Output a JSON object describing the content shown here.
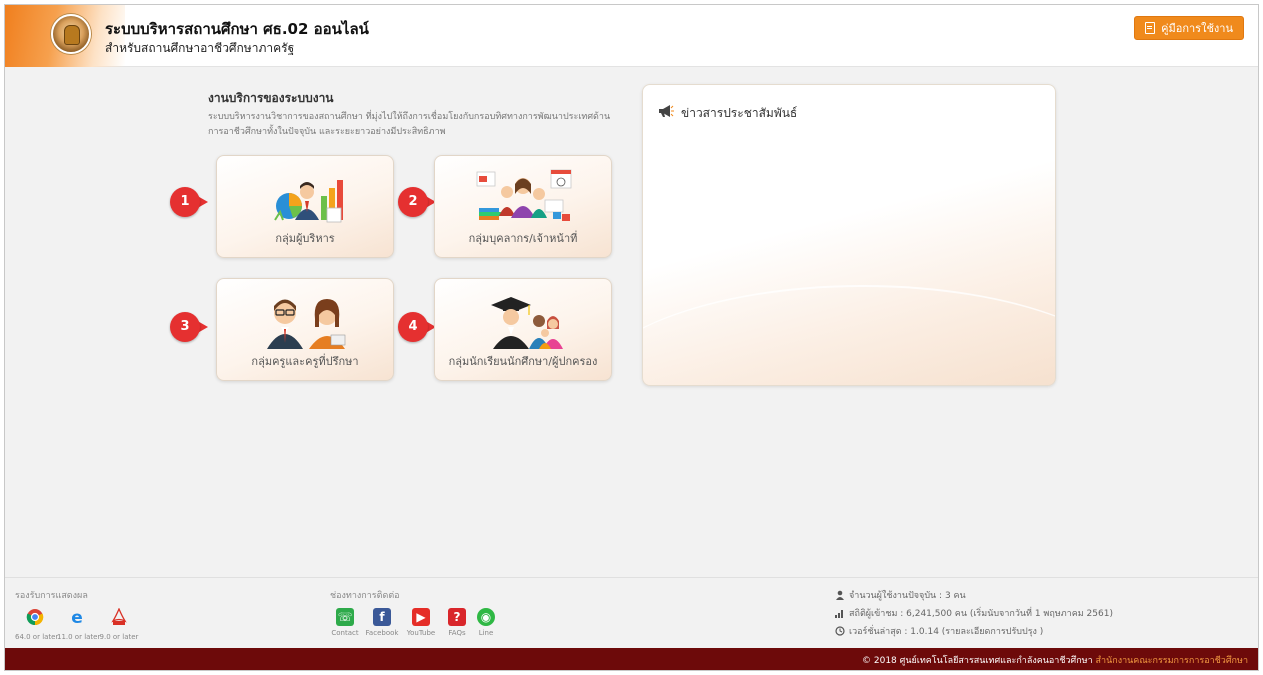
{
  "header": {
    "title": "ระบบบริหารสถานศึกษา ศธ.02 ออนไลน์",
    "subtitle": "สำหรับสถานศึกษาอาชีวศึกษาภาครัฐ",
    "manual_button": "คู่มือการใช้งาน",
    "logo_icon": "institution-seal-logo",
    "accent_color": "#f08a1c"
  },
  "services": {
    "title": "งานบริการของระบบงาน",
    "description_line1": "ระบบบริหารงานวิชาการของสถานศึกษา ที่มุ่งไปให้ถึงการเชื่อมโยงกับกรอบทิศทางการพัฒนาประเทศด้าน",
    "description_line2": "การอาชีวศึกษาทั้งในปัจจุบัน และระยะยาวอย่างมีประสิทธิภาพ",
    "cards": [
      {
        "number": "1",
        "label": "กลุ่มผู้บริหาร",
        "icon": "executive-charts-icon"
      },
      {
        "number": "2",
        "label": "กลุ่มบุคลากร/เจ้าหน้าที่",
        "icon": "staff-group-icon"
      },
      {
        "number": "3",
        "label": "กลุ่มครูและครูที่ปรึกษา",
        "icon": "teachers-icon"
      },
      {
        "number": "4",
        "label": "กลุ่มนักเรียนนักศึกษา/ผู้ปกครอง",
        "icon": "graduate-family-icon"
      }
    ],
    "badge_color": "#e53030"
  },
  "news": {
    "title": "ข่าวสารประชาสัมพันธ์",
    "icon": "megaphone-icon"
  },
  "footer": {
    "browsers_title": "รองรับการแสดงผล",
    "browsers": [
      {
        "icon": "chrome-icon",
        "caption": "64.0 or later"
      },
      {
        "icon": "ie-icon",
        "caption": "11.0 or later"
      },
      {
        "icon": "pdf-icon",
        "caption": "9.0 or later"
      }
    ],
    "contacts_title": "ช่องทางการติดต่อ",
    "contacts": [
      {
        "icon": "phone-icon",
        "caption": "Contact",
        "color": "#2eaa4a"
      },
      {
        "icon": "facebook-icon",
        "caption": "Facebook",
        "color": "#3b5998"
      },
      {
        "icon": "youtube-icon",
        "caption": "YouTube",
        "color": "#e52d27"
      },
      {
        "icon": "faq-icon",
        "caption": "FAQs",
        "color": "#d9262b"
      },
      {
        "icon": "line-icon",
        "caption": "Line",
        "color": "#2fb844"
      }
    ],
    "stats": {
      "online_users": "จำนวนผู้ใช้งานปัจจุบัน : 3 คน",
      "visitors": "สถิติผู้เข้าชม : 6,241,500 คน (เริ่มนับจากวันที่ 1 พฤษภาคม 2561)",
      "version": "เวอร์ชั่นล่าสุด : 1.0.14 (รายละเอียดการปรับปรุง )"
    }
  },
  "bottom_bar": {
    "copyright": "© 2018 ศูนย์เทคโนโลยีสารสนเทศและกำลังคนอาชีวศึกษา",
    "org": "สำนักงานคณะกรรมการการอาชีวศึกษา",
    "color": "#6d0a0a"
  }
}
